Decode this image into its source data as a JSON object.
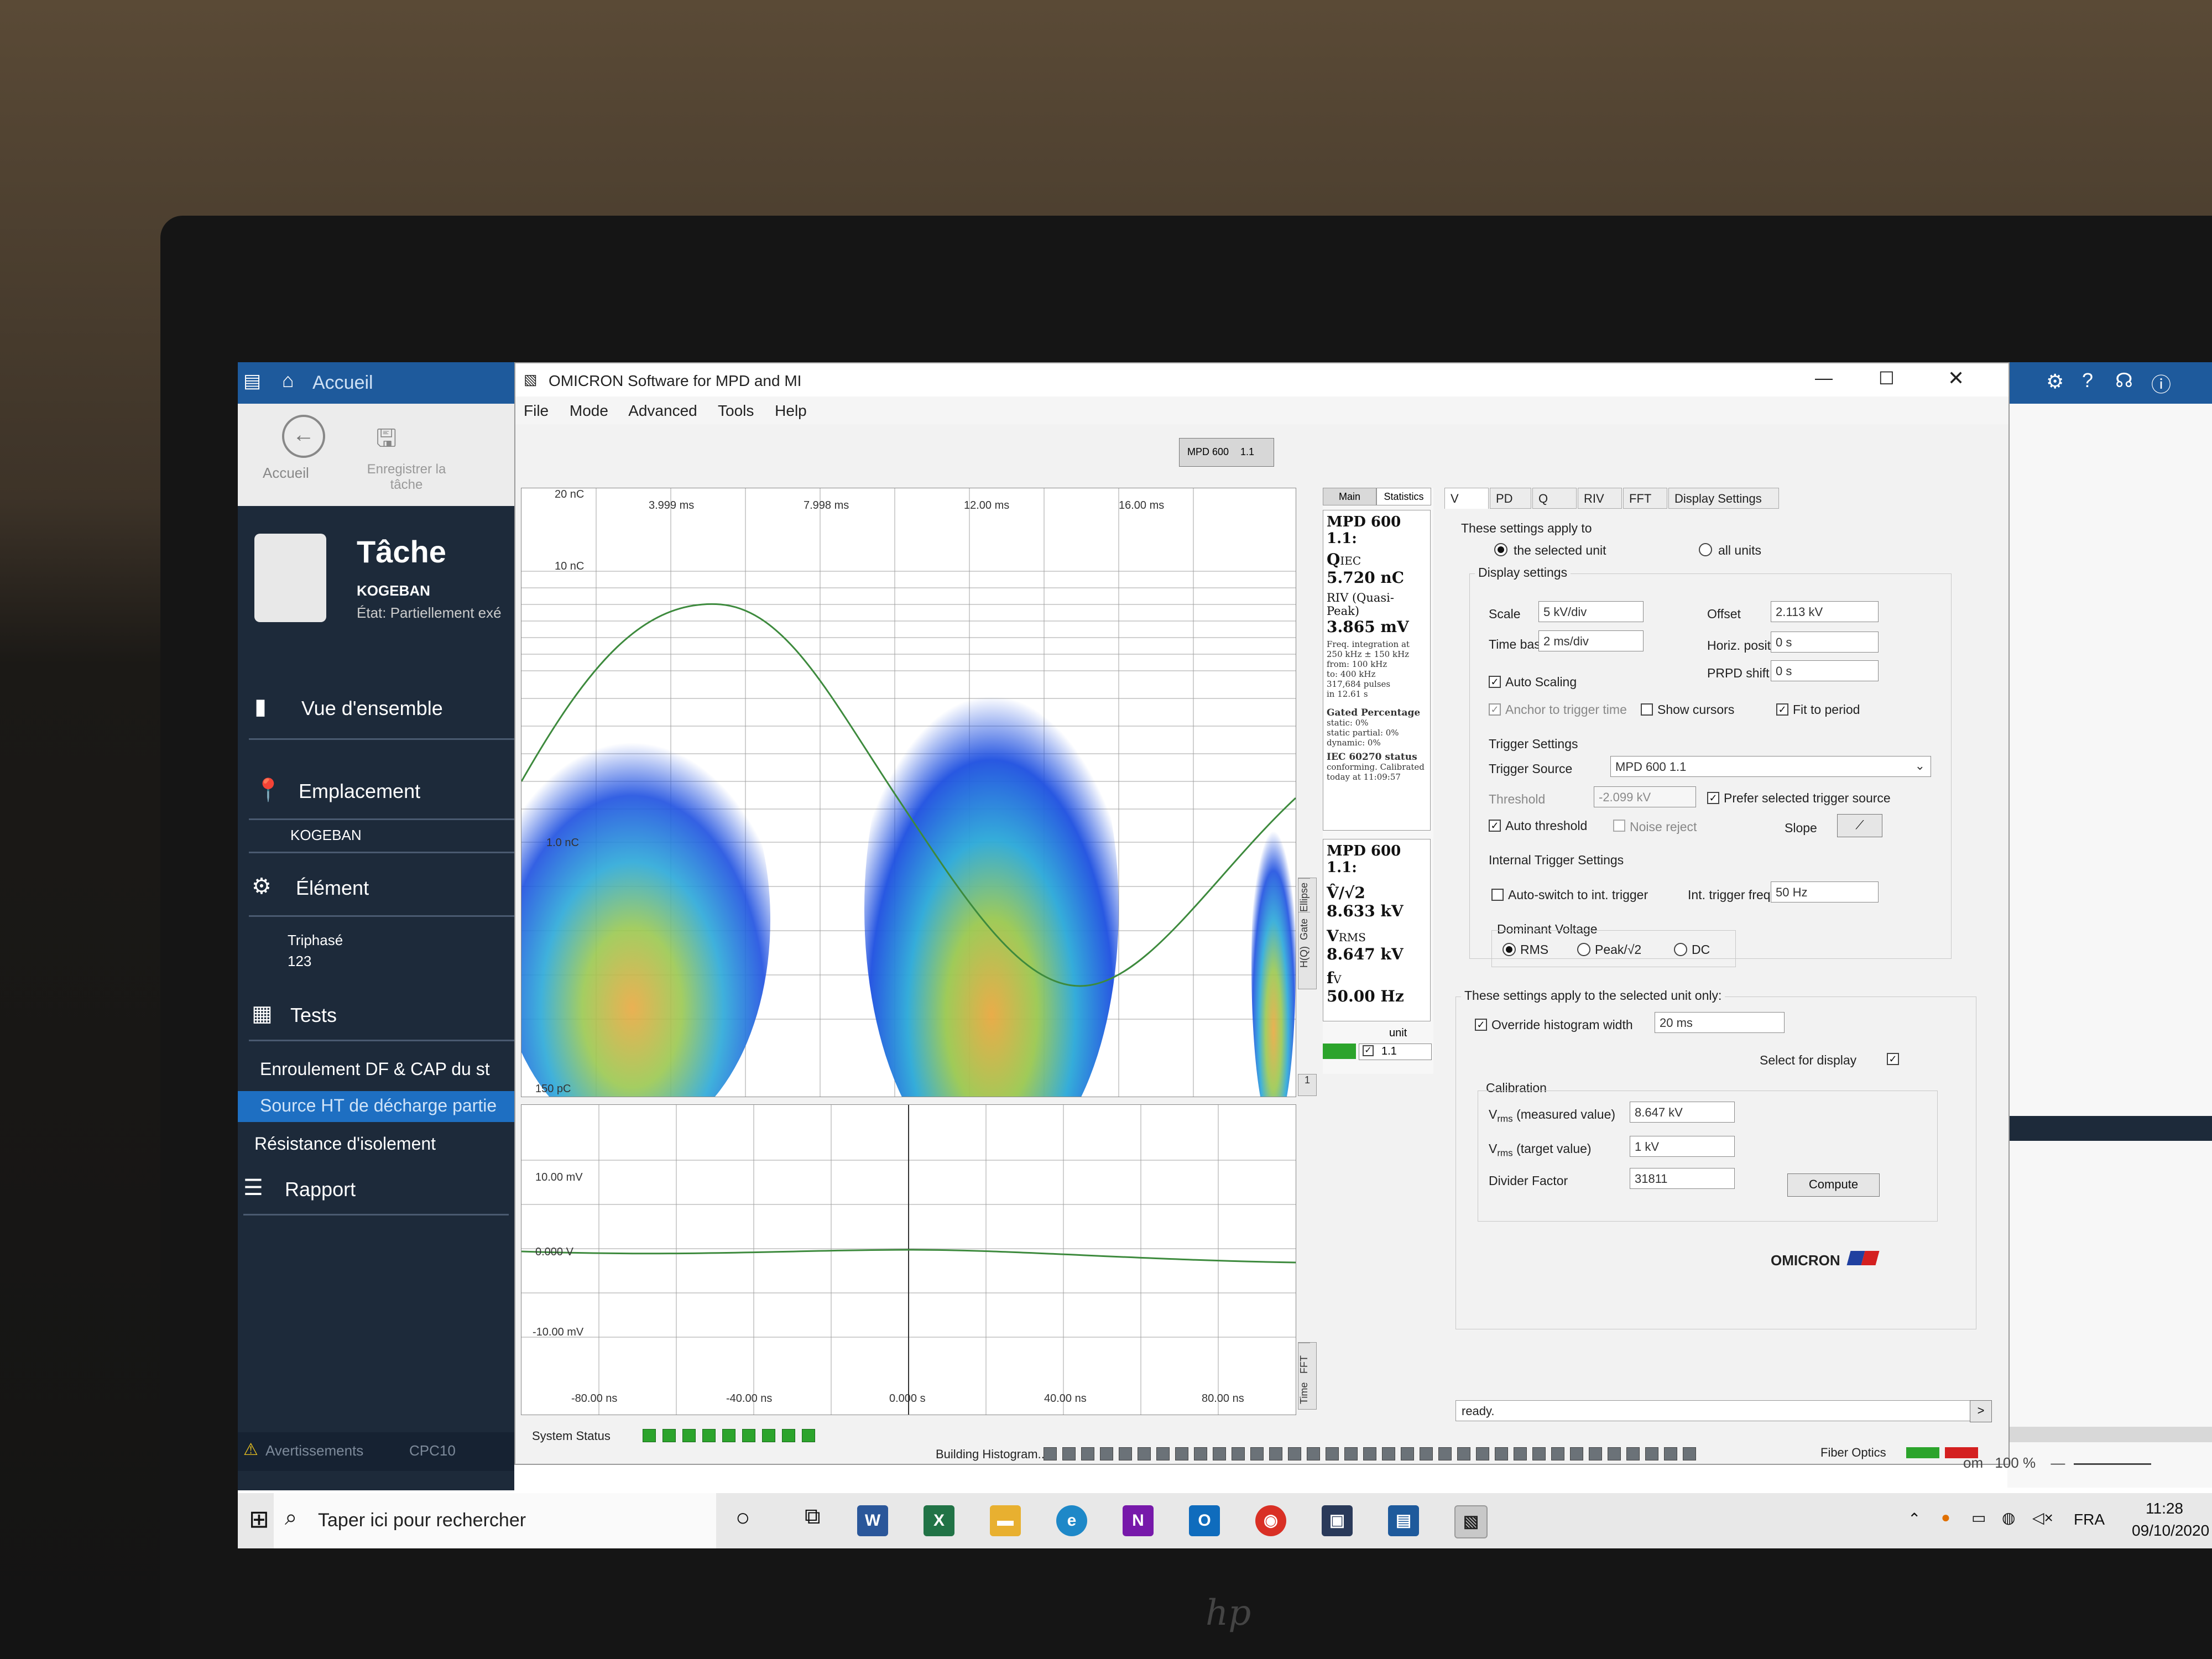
{
  "background_app": {
    "title": "Accueil",
    "ribbon": {
      "home_label": "Accueil",
      "save_label": "Enregistrer la tâche"
    },
    "task": {
      "title": "Tâche",
      "subtitle": "KOGEBAN",
      "status": "État: Partiellement exé"
    },
    "nav": {
      "overview": "Vue d'ensemble",
      "location": "Emplacement",
      "location_value": "KOGEBAN",
      "element": "Élément",
      "element_value_1": "Triphasé",
      "element_value_2": "123",
      "tests": "Tests",
      "test_1": "Enroulement DF & CAP du st",
      "test_2": "Source HT de décharge partie",
      "test_3": "Résistance d'isolement",
      "report": "Rapport"
    },
    "footer": {
      "warnings": "Avertissements",
      "device": "CPC10"
    },
    "zoom": {
      "label": "om",
      "value": "100 %"
    }
  },
  "window": {
    "title": "OMICRON Software for MPD and MI",
    "menu": [
      "File",
      "Mode",
      "Advanced",
      "Tools",
      "Help"
    ],
    "device_badge": "MPD 600",
    "device_badge_unit": "1.1"
  },
  "prpd_plot": {
    "y_labels": {
      "top": "20 nC",
      "second": "10 nC",
      "mid": "1.0 nC",
      "bottom": "150 pC"
    },
    "x_labels": [
      "3.999 ms",
      "7.998 ms",
      "12.00 ms",
      "16.00 ms"
    ],
    "side_tabs": [
      "Ellipse",
      "Gate",
      "H(Q)",
      "1"
    ]
  },
  "scope_plot": {
    "y_labels": [
      "10.00 mV",
      "0.000 V",
      "-10.00 mV"
    ],
    "x_labels": [
      "-80.00 ns",
      "-40.00 ns",
      "0.000 s",
      "40.00 ns",
      "80.00 ns"
    ],
    "side_tabs": [
      "FFT",
      "Time"
    ]
  },
  "meas_panel": {
    "tabs": [
      "Main",
      "Statistics"
    ],
    "box1": {
      "unit": "MPD 600 1.1:",
      "q_label": "Q",
      "q_sub": "IEC",
      "q_value": "5.720 nC",
      "riv_label": "RIV (Quasi-Peak)",
      "riv_value": "3.865 mV",
      "freq_lines": [
        "Freq. integration at",
        "250 kHz ± 150 kHz",
        "from: 100 kHz",
        "to: 400 kHz",
        "317,684 pulses",
        "in 12.61 s"
      ],
      "gated_title": "Gated Percentage",
      "gated_lines": [
        "static: 0%",
        "static partial: 0%",
        "dynamic: 0%"
      ],
      "iec_title": "IEC 60270 status",
      "iec_lines": [
        "conforming. Calibrated",
        "today at 11:09:57"
      ]
    },
    "box2": {
      "unit": "MPD 600 1.1:",
      "v_label": "V̂/√2",
      "v_value": "8.633 kV",
      "vrms_label": "V",
      "vrms_sub": "RMS",
      "vrms_value": "8.647 kV",
      "f_label": "f",
      "f_sub": "V",
      "f_value": "50.00 Hz"
    },
    "unit_header": "unit",
    "unit_value": "1.1"
  },
  "settings": {
    "tabs": [
      "V",
      "PD",
      "Q",
      "RIV",
      "FFT",
      "Display Settings"
    ],
    "apply_to": "These settings apply to",
    "opt_selected": "the selected unit",
    "opt_all": "all units",
    "display_settings": "Display settings",
    "scale_label": "Scale",
    "scale_value": "5 kV/div",
    "offset_label": "Offset",
    "offset_value": "2.113 kV",
    "timebase_label": "Time base",
    "timebase_value": "2 ms/div",
    "horiz_label": "Horiz. position",
    "horiz_value": "0 s",
    "prpd_label": "PRPD shift",
    "prpd_value": "0 s",
    "auto_scaling": "Auto Scaling",
    "anchor": "Anchor to trigger time",
    "show_cursors": "Show cursors",
    "fit_period": "Fit to period",
    "trigger_settings": "Trigger Settings",
    "trigger_source_label": "Trigger Source",
    "trigger_source_value": "MPD 600 1.1",
    "threshold_label": "Threshold",
    "threshold_value": "-2.099 kV",
    "prefer_trigger": "Prefer selected trigger source",
    "auto_threshold": "Auto threshold",
    "noise_reject": "Noise reject",
    "slope_label": "Slope",
    "internal_trigger": "Internal Trigger Settings",
    "auto_switch": "Auto-switch to int. trigger",
    "int_freq_label": "Int. trigger freq.",
    "int_freq_value": "50 Hz",
    "dominant_voltage": "Dominant Voltage",
    "dv_rms": "RMS",
    "dv_peak": "Peak/√2",
    "dv_dc": "DC",
    "selected_only": "These settings apply to the selected unit only:",
    "override_hist": "Override histogram width",
    "override_value": "20 ms",
    "select_display": "Select for display",
    "calibration": "Calibration",
    "vrms_measured_label": "(measured value)",
    "vrms_measured_value": "8.647 kV",
    "vrms_target_label": "(target value)",
    "vrms_target_value": "1 kV",
    "v_letter": "V",
    "rms_sub": "rms",
    "divider_label": "Divider Factor",
    "divider_value": "31811",
    "compute_button": "Compute",
    "brand": "OMICRON"
  },
  "status": {
    "system_status": "System Status",
    "building": "Building Histogram...",
    "ready": "ready.",
    "fiber": "Fiber Optics"
  },
  "taskbar": {
    "search_placeholder": "Taper ici pour rechercher",
    "apps": [
      "W",
      "X",
      "N",
      "O"
    ],
    "language": "FRA",
    "time": "11:28",
    "date": "09/10/2020"
  },
  "colors": {
    "accent_blue": "#1e5a9c",
    "nav_dark": "#1d2a3a",
    "status_green": "#2ca42c",
    "status_red": "#d42020",
    "waveform": "#3d8a3d"
  }
}
